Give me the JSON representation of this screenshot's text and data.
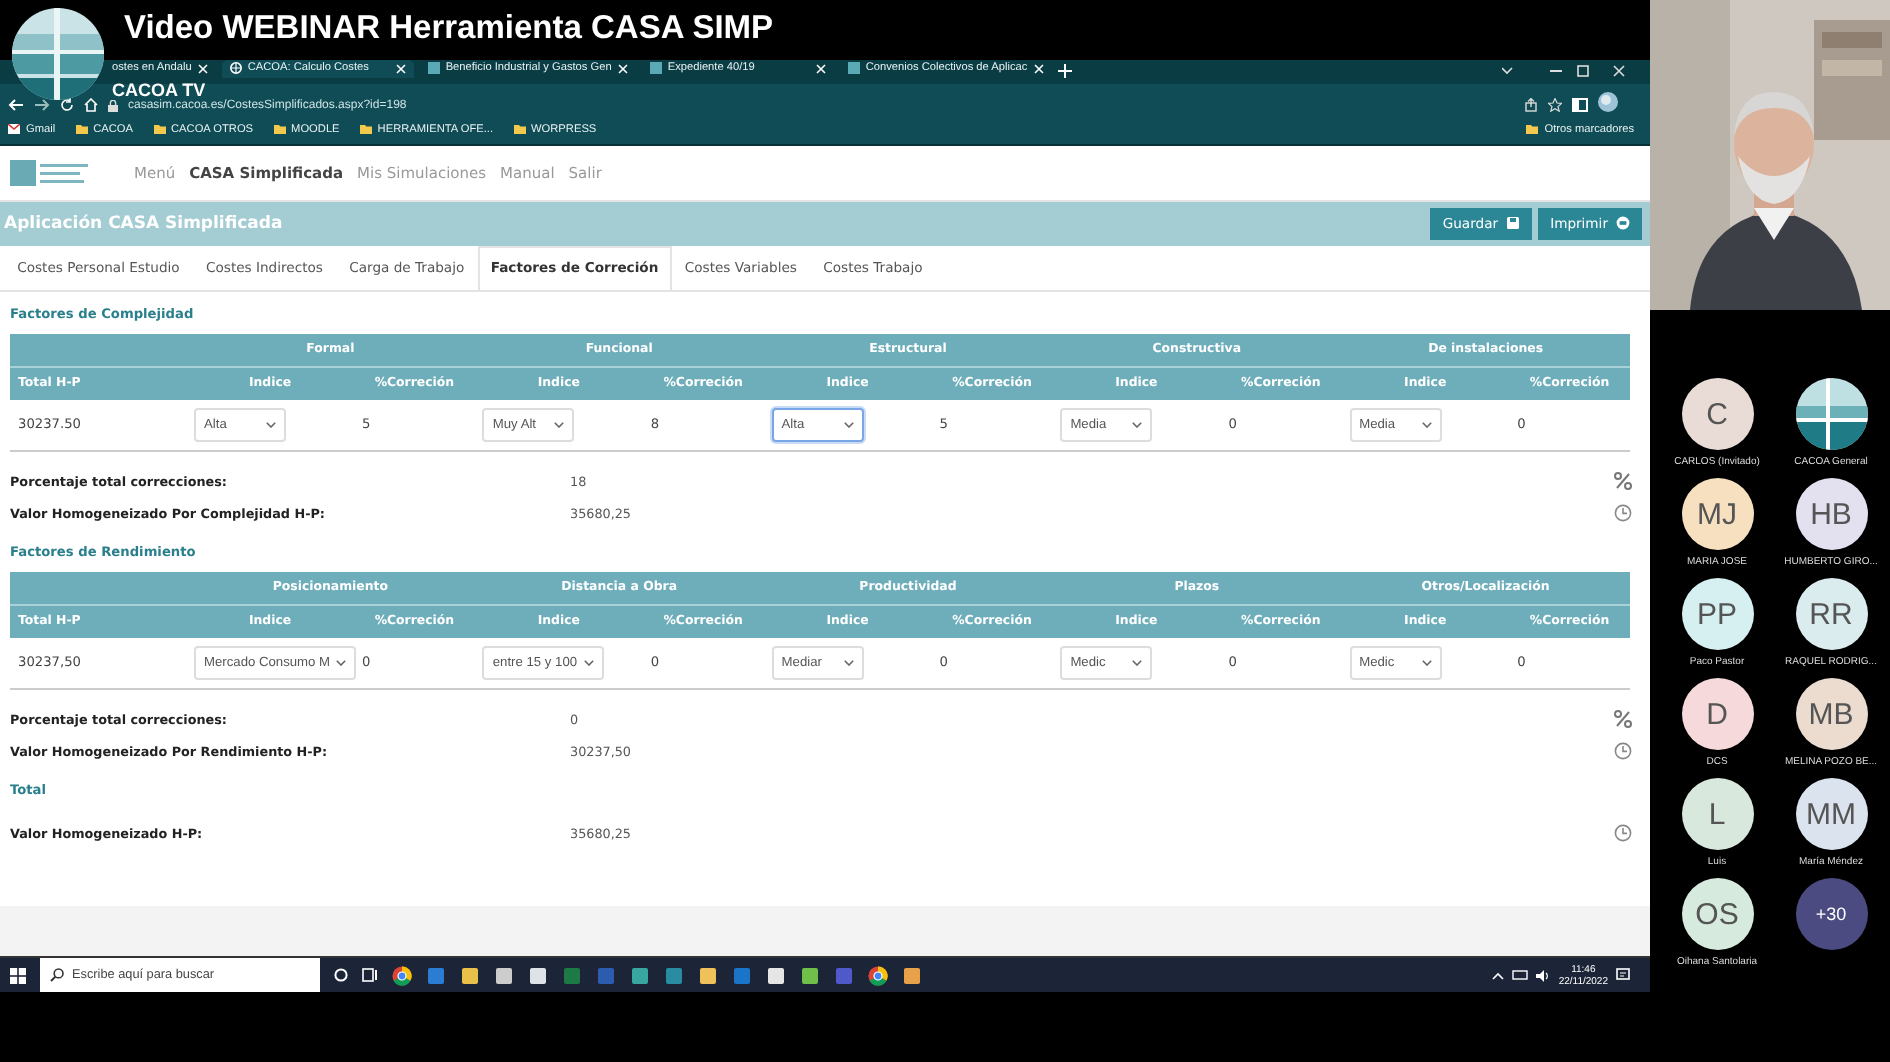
{
  "overlay": {
    "title": "Video WEBINAR Herramienta CASA SIMP",
    "channel": "CACOA TV"
  },
  "browser": {
    "tabs": [
      {
        "label": "ostes en Andalu",
        "selected": false
      },
      {
        "label": "CACOA: Calculo Costes",
        "selected": true
      },
      {
        "label": "Beneficio Industrial y Gastos Gen",
        "selected": false
      },
      {
        "label": "Expediente 40/19",
        "selected": false
      },
      {
        "label": "Convenios Colectivos de Aplicac",
        "selected": false
      }
    ],
    "url": "casasim.cacoa.es/CostesSimplificados.aspx?id=198",
    "bookmarks": [
      {
        "label": "Gmail",
        "kind": "mail"
      },
      {
        "label": "CACOA",
        "kind": "folder"
      },
      {
        "label": "CACOA OTROS",
        "kind": "folder"
      },
      {
        "label": "MOODLE",
        "kind": "folder"
      },
      {
        "label": "HERRAMIENTA OFE...",
        "kind": "folder"
      },
      {
        "label": "WORPRESS",
        "kind": "folder"
      }
    ],
    "other_bookmarks": "Otros marcadores"
  },
  "app": {
    "nav": [
      {
        "label": "Menú",
        "selected": false
      },
      {
        "label": "CASA Simplificada",
        "selected": true
      },
      {
        "label": "Mis Simulaciones",
        "selected": false
      },
      {
        "label": "Manual",
        "selected": false
      },
      {
        "label": "Salir",
        "selected": false
      }
    ],
    "header": "Aplicación CASA Simplificada",
    "buttons": [
      {
        "label": "Guardar"
      },
      {
        "label": "Imprimir"
      }
    ],
    "tabs": [
      {
        "label": "Costes Personal Estudio",
        "selected": false
      },
      {
        "label": "Costes Indirectos",
        "selected": false
      },
      {
        "label": "Carga de Trabajo",
        "selected": false
      },
      {
        "label": "Factores de Correción",
        "selected": true
      },
      {
        "label": "Costes Variables",
        "selected": false
      },
      {
        "label": "Costes Trabajo",
        "selected": false
      }
    ],
    "sections": [
      {
        "title": "Factores de Complejidad",
        "total_header": "Total H-P",
        "total": "30237.50",
        "groups": [
          {
            "name": "Formal",
            "index_header": "Indice",
            "corr_header": "%Correción",
            "index": "Alta",
            "corr": "5",
            "focused": false
          },
          {
            "name": "Funcional",
            "index_header": "Indice",
            "corr_header": "%Correción",
            "index": "Muy Alt",
            "corr": "8",
            "focused": false
          },
          {
            "name": "Estructural",
            "index_header": "Indice",
            "corr_header": "%Correción",
            "index": "Alta",
            "corr": "5",
            "focused": true
          },
          {
            "name": "Constructiva",
            "index_header": "Indice",
            "corr_header": "%Correción",
            "index": "Media",
            "corr": "0",
            "focused": false
          },
          {
            "name": "De instalaciones",
            "index_header": "Indice",
            "corr_header": "%Correción",
            "index": "Media",
            "corr": "0",
            "focused": false
          }
        ],
        "summary": [
          {
            "label": "Porcentaje total correcciones:",
            "value": "18"
          },
          {
            "label": "Valor Homogeneizado Por Complejidad H-P:",
            "value": "35680,25"
          }
        ]
      },
      {
        "title": "Factores de Rendimiento",
        "total_header": "Total H-P",
        "total": "30237,50",
        "groups": [
          {
            "name": "Posicionamiento",
            "index_header": "Indice",
            "corr_header": "%Correción",
            "index": "Mercado Consumo M",
            "corr": "0",
            "focused": false
          },
          {
            "name": "Distancia a Obra",
            "index_header": "Indice",
            "corr_header": "%Correción",
            "index": "entre 15 y 100",
            "corr": "0",
            "focused": false
          },
          {
            "name": "Productividad",
            "index_header": "Indice",
            "corr_header": "%Correción",
            "index": "Mediar",
            "corr": "0",
            "focused": false
          },
          {
            "name": "Plazos",
            "index_header": "Indice",
            "corr_header": "%Correción",
            "index": "Medic",
            "corr": "0",
            "focused": false
          },
          {
            "name": "Otros/Localización",
            "index_header": "Indice",
            "corr_header": "%Correción",
            "index": "Medic",
            "corr": "0",
            "focused": false
          }
        ],
        "summary": [
          {
            "label": "Porcentaje total correcciones:",
            "value": "0"
          },
          {
            "label": "Valor Homogeneizado Por Rendimiento H-P:",
            "value": "30237,50"
          }
        ]
      }
    ],
    "total": {
      "title": "Total",
      "label": "Valor Homogeneizado H-P:",
      "value": "35680,25"
    }
  },
  "taskbar": {
    "search_placeholder": "Escribe aquí para buscar",
    "time": "11:46",
    "date": "22/11/2022"
  },
  "participants": [
    {
      "kind": "initials",
      "initials": "C",
      "name": "CARLOS (Invitado)",
      "color": "#e9dcd6"
    },
    {
      "kind": "logo",
      "name": "CACOA General"
    },
    {
      "kind": "initials",
      "initials": "MJ",
      "name": "MARIA JOSE",
      "color": "#f7e0c0"
    },
    {
      "kind": "initials",
      "initials": "HB",
      "name": "HUMBERTO GIRO...",
      "color": "#e3e1f0"
    },
    {
      "kind": "initials",
      "initials": "PP",
      "name": "Paco Pastor",
      "color": "#d6f0f2"
    },
    {
      "kind": "initials",
      "initials": "RR",
      "name": "RAQUEL RODRIG...",
      "color": "#dbecee"
    },
    {
      "kind": "initials",
      "initials": "D",
      "name": "DCS",
      "color": "#f6d9da"
    },
    {
      "kind": "initials",
      "initials": "MB",
      "name": "MELINA POZO BE...",
      "color": "#ecdcd0"
    },
    {
      "kind": "initials",
      "initials": "L",
      "name": "Luis",
      "color": "#d9e8dd"
    },
    {
      "kind": "initials",
      "initials": "MM",
      "name": "María Méndez",
      "color": "#dbe4ee"
    },
    {
      "kind": "initials",
      "initials": "OS",
      "name": "Oihana Santolaria",
      "color": "#d6ebdd"
    },
    {
      "kind": "more",
      "initials": "+30",
      "color": "#4b4b82"
    }
  ]
}
